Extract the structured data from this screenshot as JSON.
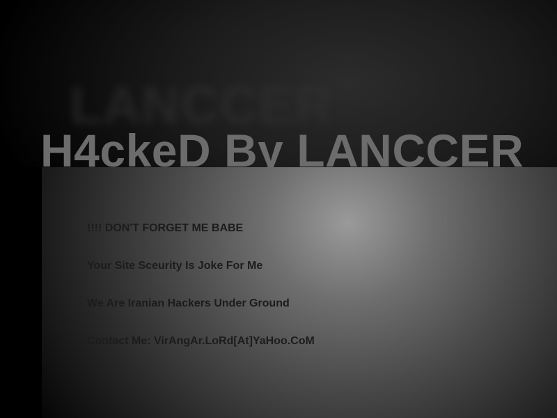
{
  "headline": {
    "text": "H4ckeD By LANCCER"
  },
  "messages": [
    {
      "text": "!!!! DON'T FORGET ME BABE"
    },
    {
      "text": "Your Site Sceurity Is Joke For Me"
    },
    {
      "text": "We Are Iranian Hackers Under Ground"
    },
    {
      "text": "Contact Me: VirAngAr.LoRd[At]YaHoo.CoM"
    }
  ],
  "colors": {
    "background": "#000000",
    "text": "#1c1c1c",
    "headline": "#6c6c6c"
  }
}
